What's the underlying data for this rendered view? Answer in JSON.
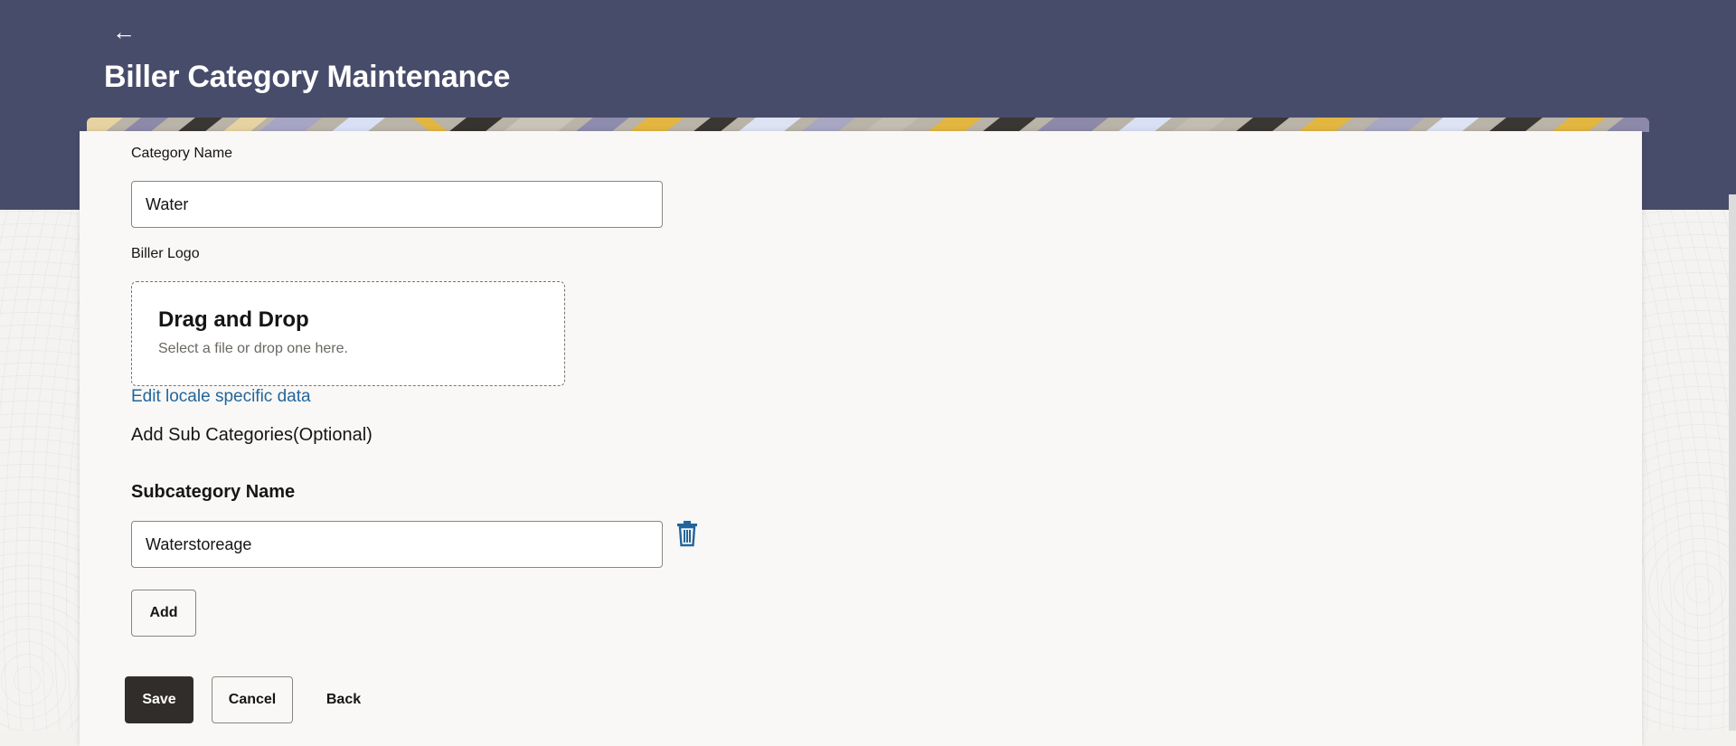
{
  "header": {
    "title": "Biller Category Maintenance",
    "back_icon": "arrow-left-icon",
    "background_color": "#484c6b"
  },
  "form": {
    "category_name": {
      "label": "Category Name",
      "value": "Water"
    },
    "biller_logo": {
      "label": "Biller Logo",
      "dropzone_title": "Drag and Drop",
      "dropzone_hint": "Select a file or drop one here."
    },
    "locale_link": "Edit locale specific data",
    "sub_categories_heading": "Add Sub Categories(Optional)",
    "subcategory": {
      "label": "Subcategory Name",
      "value": "Waterstoreage",
      "delete_icon": "trash-icon"
    },
    "add_button": "Add"
  },
  "actions": {
    "save": "Save",
    "cancel": "Cancel",
    "back": "Back"
  },
  "colors": {
    "link": "#23659b",
    "primary_button": "#312d2a",
    "card_background": "#f9f8f6"
  }
}
